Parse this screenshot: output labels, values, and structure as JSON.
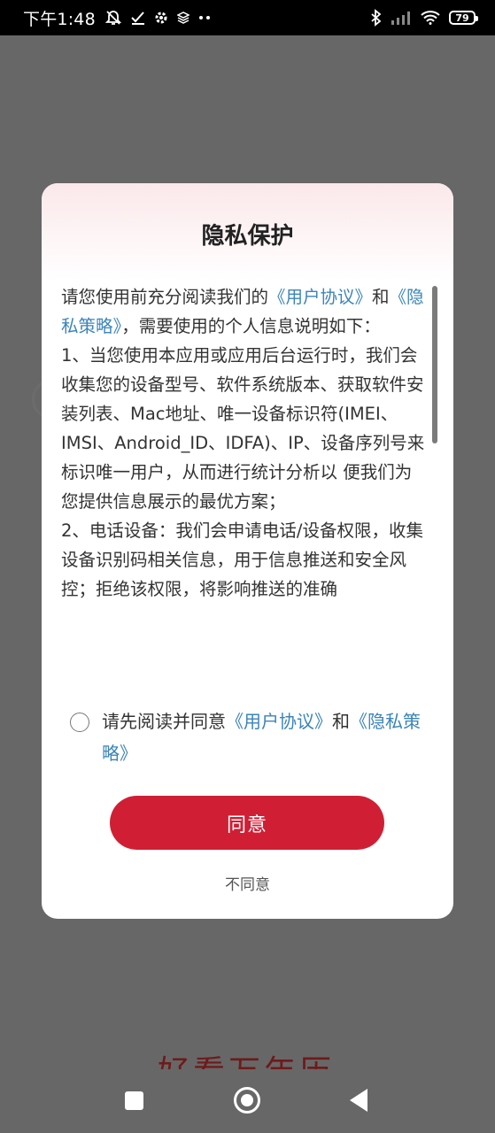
{
  "status_bar": {
    "time": "下午1:48",
    "left_icons": [
      "mute-bell-icon",
      "check-icon",
      "gear-icon",
      "layers-icon",
      "more-dots-icon"
    ],
    "right_icons": [
      "bluetooth-icon",
      "signal-icon",
      "wifi-icon"
    ],
    "battery": "79"
  },
  "background": {
    "app_title": "好看万年历"
  },
  "dialog": {
    "title": "隐私保护",
    "body": {
      "intro_prefix": "请您使用前充分阅读我们的",
      "user_agreement_link": "《用户协议》",
      "and": "和",
      "privacy_policy_link": "《隐私策略》",
      "intro_suffix": "，需要使用的个人信息说明如下：",
      "item1": "1、当您使用本应用或应用后台运行时，我们会收集您的设备型号、软件系统版本、获取软件安装列表、Mac地址、唯一设备标识符(IMEI、IMSI、Android_ID、IDFA)、IP、设备序列号来标识唯一用户，从而进行统计分析以 便我们为您提供信息展示的最优方案；",
      "item2": "2、电话设备：我们会申请电话/设备权限，收集设备识别码相关信息，用于信息推送和安全风控；拒绝该权限，将影响推送的准确"
    },
    "consent": {
      "prefix": "请先阅读并同意",
      "user_agreement_link": "《用户协议》",
      "and": "和",
      "privacy_policy_link": "《隐私策略》",
      "checked": false
    },
    "agree_button": "同意",
    "disagree_button": "不同意"
  },
  "nav_bar": {
    "items": [
      "recents-square-icon",
      "home-circle-icon",
      "back-triangle-icon"
    ]
  },
  "colors": {
    "accent": "#d01f34",
    "link": "#3b84b9",
    "overlay": "#676767"
  }
}
